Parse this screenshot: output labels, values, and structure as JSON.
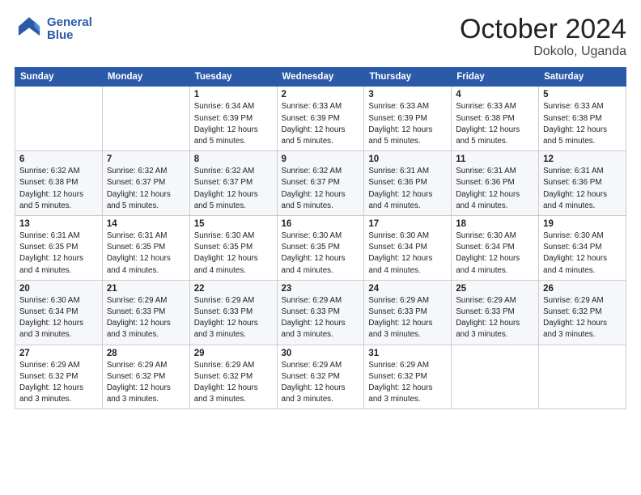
{
  "header": {
    "logo_line1": "General",
    "logo_line2": "Blue",
    "month": "October 2024",
    "location": "Dokolo, Uganda"
  },
  "weekdays": [
    "Sunday",
    "Monday",
    "Tuesday",
    "Wednesday",
    "Thursday",
    "Friday",
    "Saturday"
  ],
  "weeks": [
    [
      {
        "day": "",
        "info": ""
      },
      {
        "day": "",
        "info": ""
      },
      {
        "day": "1",
        "info": "Sunrise: 6:34 AM\nSunset: 6:39 PM\nDaylight: 12 hours and 5 minutes."
      },
      {
        "day": "2",
        "info": "Sunrise: 6:33 AM\nSunset: 6:39 PM\nDaylight: 12 hours and 5 minutes."
      },
      {
        "day": "3",
        "info": "Sunrise: 6:33 AM\nSunset: 6:39 PM\nDaylight: 12 hours and 5 minutes."
      },
      {
        "day": "4",
        "info": "Sunrise: 6:33 AM\nSunset: 6:38 PM\nDaylight: 12 hours and 5 minutes."
      },
      {
        "day": "5",
        "info": "Sunrise: 6:33 AM\nSunset: 6:38 PM\nDaylight: 12 hours and 5 minutes."
      }
    ],
    [
      {
        "day": "6",
        "info": "Sunrise: 6:32 AM\nSunset: 6:38 PM\nDaylight: 12 hours and 5 minutes."
      },
      {
        "day": "7",
        "info": "Sunrise: 6:32 AM\nSunset: 6:37 PM\nDaylight: 12 hours and 5 minutes."
      },
      {
        "day": "8",
        "info": "Sunrise: 6:32 AM\nSunset: 6:37 PM\nDaylight: 12 hours and 5 minutes."
      },
      {
        "day": "9",
        "info": "Sunrise: 6:32 AM\nSunset: 6:37 PM\nDaylight: 12 hours and 5 minutes."
      },
      {
        "day": "10",
        "info": "Sunrise: 6:31 AM\nSunset: 6:36 PM\nDaylight: 12 hours and 4 minutes."
      },
      {
        "day": "11",
        "info": "Sunrise: 6:31 AM\nSunset: 6:36 PM\nDaylight: 12 hours and 4 minutes."
      },
      {
        "day": "12",
        "info": "Sunrise: 6:31 AM\nSunset: 6:36 PM\nDaylight: 12 hours and 4 minutes."
      }
    ],
    [
      {
        "day": "13",
        "info": "Sunrise: 6:31 AM\nSunset: 6:35 PM\nDaylight: 12 hours and 4 minutes."
      },
      {
        "day": "14",
        "info": "Sunrise: 6:31 AM\nSunset: 6:35 PM\nDaylight: 12 hours and 4 minutes."
      },
      {
        "day": "15",
        "info": "Sunrise: 6:30 AM\nSunset: 6:35 PM\nDaylight: 12 hours and 4 minutes."
      },
      {
        "day": "16",
        "info": "Sunrise: 6:30 AM\nSunset: 6:35 PM\nDaylight: 12 hours and 4 minutes."
      },
      {
        "day": "17",
        "info": "Sunrise: 6:30 AM\nSunset: 6:34 PM\nDaylight: 12 hours and 4 minutes."
      },
      {
        "day": "18",
        "info": "Sunrise: 6:30 AM\nSunset: 6:34 PM\nDaylight: 12 hours and 4 minutes."
      },
      {
        "day": "19",
        "info": "Sunrise: 6:30 AM\nSunset: 6:34 PM\nDaylight: 12 hours and 4 minutes."
      }
    ],
    [
      {
        "day": "20",
        "info": "Sunrise: 6:30 AM\nSunset: 6:34 PM\nDaylight: 12 hours and 3 minutes."
      },
      {
        "day": "21",
        "info": "Sunrise: 6:29 AM\nSunset: 6:33 PM\nDaylight: 12 hours and 3 minutes."
      },
      {
        "day": "22",
        "info": "Sunrise: 6:29 AM\nSunset: 6:33 PM\nDaylight: 12 hours and 3 minutes."
      },
      {
        "day": "23",
        "info": "Sunrise: 6:29 AM\nSunset: 6:33 PM\nDaylight: 12 hours and 3 minutes."
      },
      {
        "day": "24",
        "info": "Sunrise: 6:29 AM\nSunset: 6:33 PM\nDaylight: 12 hours and 3 minutes."
      },
      {
        "day": "25",
        "info": "Sunrise: 6:29 AM\nSunset: 6:33 PM\nDaylight: 12 hours and 3 minutes."
      },
      {
        "day": "26",
        "info": "Sunrise: 6:29 AM\nSunset: 6:32 PM\nDaylight: 12 hours and 3 minutes."
      }
    ],
    [
      {
        "day": "27",
        "info": "Sunrise: 6:29 AM\nSunset: 6:32 PM\nDaylight: 12 hours and 3 minutes."
      },
      {
        "day": "28",
        "info": "Sunrise: 6:29 AM\nSunset: 6:32 PM\nDaylight: 12 hours and 3 minutes."
      },
      {
        "day": "29",
        "info": "Sunrise: 6:29 AM\nSunset: 6:32 PM\nDaylight: 12 hours and 3 minutes."
      },
      {
        "day": "30",
        "info": "Sunrise: 6:29 AM\nSunset: 6:32 PM\nDaylight: 12 hours and 3 minutes."
      },
      {
        "day": "31",
        "info": "Sunrise: 6:29 AM\nSunset: 6:32 PM\nDaylight: 12 hours and 3 minutes."
      },
      {
        "day": "",
        "info": ""
      },
      {
        "day": "",
        "info": ""
      }
    ]
  ]
}
